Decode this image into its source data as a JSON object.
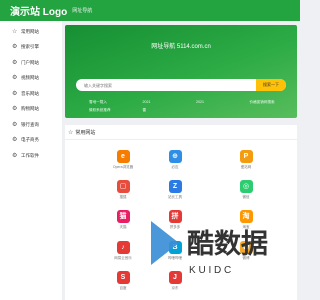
{
  "header": {
    "logo": "演示站 Logo",
    "subtitle": "网址导航"
  },
  "sidebar": {
    "items": [
      {
        "icon": "star-icon",
        "glyph": "☆",
        "label": "常用网站"
      },
      {
        "icon": "gear-icon",
        "glyph": "⚙",
        "label": "搜索引擎"
      },
      {
        "icon": "gear-icon",
        "glyph": "⚙",
        "label": "门户网站"
      },
      {
        "icon": "gear-icon",
        "glyph": "⚙",
        "label": "视频网站"
      },
      {
        "icon": "gear-icon",
        "glyph": "⚙",
        "label": "音乐网站"
      },
      {
        "icon": "gear-icon",
        "glyph": "⚙",
        "label": "购物网站"
      },
      {
        "icon": "gear-icon",
        "glyph": "⚙",
        "label": "银行查询"
      },
      {
        "icon": "gear-icon",
        "glyph": "⚙",
        "label": "电子商务"
      },
      {
        "icon": "gear-icon",
        "glyph": "⚙",
        "label": "工作软件"
      }
    ]
  },
  "hero": {
    "title": "网址导航 5114.com.cn",
    "search_placeholder": "输入关键字搜索",
    "search_button": "搜索一下",
    "chips": [
      "雪地一载入",
      "2021",
      "2021",
      "价格促销网搜索",
      "微软系统推荐",
      "雷"
    ]
  },
  "section": {
    "title": "常用网站",
    "sites": [
      {
        "label": "Opera浏览器",
        "glyph": "e",
        "color": "#f57c00",
        "icon": "opera-icon"
      },
      {
        "label": "必应",
        "glyph": "⊕",
        "color": "#2f8fe6",
        "icon": "bing-icon"
      },
      {
        "label": "爱站网",
        "glyph": "P",
        "color": "#f39c12",
        "icon": "aizhan-icon"
      },
      {
        "label": "搜狐",
        "glyph": "▢",
        "color": "#e74c3c",
        "icon": "sohu-icon"
      },
      {
        "label": "站长工具",
        "glyph": "Z",
        "color": "#2c7be5",
        "icon": "chinaz-icon"
      },
      {
        "label": "微信",
        "glyph": "◎",
        "color": "#2ecc71",
        "icon": "wechat-icon"
      },
      {
        "label": "天猫",
        "glyph": "猫",
        "color": "#e91e63",
        "icon": "tmall-icon"
      },
      {
        "label": "拼多多",
        "glyph": "拼",
        "color": "#e53935",
        "icon": "pinduoduo-icon"
      },
      {
        "label": "淘宝",
        "glyph": "淘",
        "color": "#ff9800",
        "icon": "taobao-icon"
      },
      {
        "label": "网易云音乐",
        "glyph": "♪",
        "color": "#e53935",
        "icon": "netease-music-icon"
      },
      {
        "label": "哔哩哔哩",
        "glyph": "B",
        "color": "#00a1d6",
        "icon": "bilibili-icon"
      },
      {
        "label": "微博",
        "glyph": "W",
        "color": "#f5a623",
        "icon": "weibo-icon"
      },
      {
        "label": "百度",
        "glyph": "S",
        "color": "#e53935",
        "icon": "baidu-icon"
      },
      {
        "label": "京东",
        "glyph": "J",
        "color": "#e53935",
        "icon": "jd-icon"
      }
    ]
  },
  "watermark": {
    "text": "酷数据",
    "sub": "K U I D C",
    "color": "#3b8ed6"
  }
}
